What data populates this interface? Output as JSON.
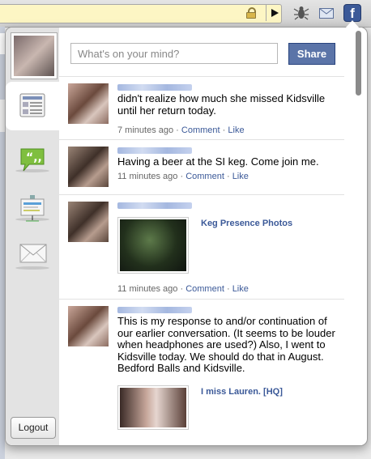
{
  "toolbar": {
    "icons": [
      "lock-icon",
      "play-icon",
      "bug-icon",
      "mail-icon",
      "facebook-icon"
    ],
    "facebook_letter": "f"
  },
  "sidebar": {
    "tabs": [
      "news-feed-icon",
      "status-updates-icon",
      "posted-items-icon",
      "messages-icon"
    ],
    "logout_label": "Logout"
  },
  "status_box": {
    "placeholder": "What's on your mind?",
    "share_label": "Share"
  },
  "feed": [
    {
      "text": "didn't realize how much she missed Kidsville until her return today.",
      "time": "7 minutes ago",
      "comment": "Comment",
      "like": "Like",
      "sep": "·"
    },
    {
      "text": "Having a beer at the SI keg. Come join me.",
      "time": "11 minutes ago",
      "comment": "Comment",
      "like": "Like",
      "sep": "·"
    },
    {
      "text": "",
      "attachment_title": "Keg Presence Photos",
      "time": "11 minutes ago",
      "comment": "Comment",
      "like": "Like",
      "sep": "·"
    },
    {
      "text": "This is my response to and/or continuation of our earlier conversation. (It seems to be louder when headphones are used?) Also, I went to Kidsville today. We should do that in August. Bedford Balls and Kidsville.",
      "attachment_title": "I miss Lauren. [HQ]"
    }
  ],
  "colors": {
    "brand": "#3b5998",
    "share_button": "#5b74a8"
  }
}
